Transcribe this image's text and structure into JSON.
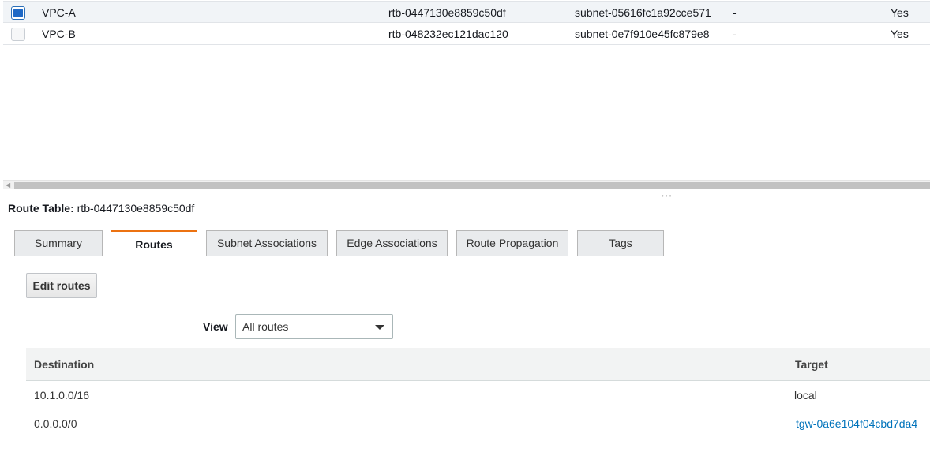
{
  "vpc_table": {
    "rows": [
      {
        "name": "VPC-A",
        "route_table": "rtb-0447130e8859c50df",
        "subnet": "subnet-05616fc1a92cce571",
        "edge": "-",
        "main": "Yes",
        "selected": true
      },
      {
        "name": "VPC-B",
        "route_table": "rtb-048232ec121dac120",
        "subnet": "subnet-0e7f910e45fc879e8",
        "edge": "-",
        "main": "Yes",
        "selected": false
      }
    ]
  },
  "details": {
    "label": "Route Table:",
    "value": "rtb-0447130e8859c50df"
  },
  "tabs": [
    {
      "label": "Summary",
      "active": false
    },
    {
      "label": "Routes",
      "active": true
    },
    {
      "label": "Subnet Associations",
      "active": false
    },
    {
      "label": "Edge Associations",
      "active": false
    },
    {
      "label": "Route Propagation",
      "active": false
    },
    {
      "label": "Tags",
      "active": false
    }
  ],
  "routes_panel": {
    "edit_button": "Edit routes",
    "view_label": "View",
    "view_selected": "All routes",
    "columns": [
      "Destination",
      "Target"
    ],
    "rows": [
      {
        "destination": "10.1.0.0/16",
        "target": "local",
        "target_is_link": false
      },
      {
        "destination": "0.0.0.0/0",
        "target": "tgw-0a6e104f04cbd7da4",
        "target_is_link": true
      }
    ]
  },
  "colors": {
    "accent_tab": "#ec7211",
    "link": "#0073bb",
    "checkbox_selected": "#1f69c6"
  }
}
